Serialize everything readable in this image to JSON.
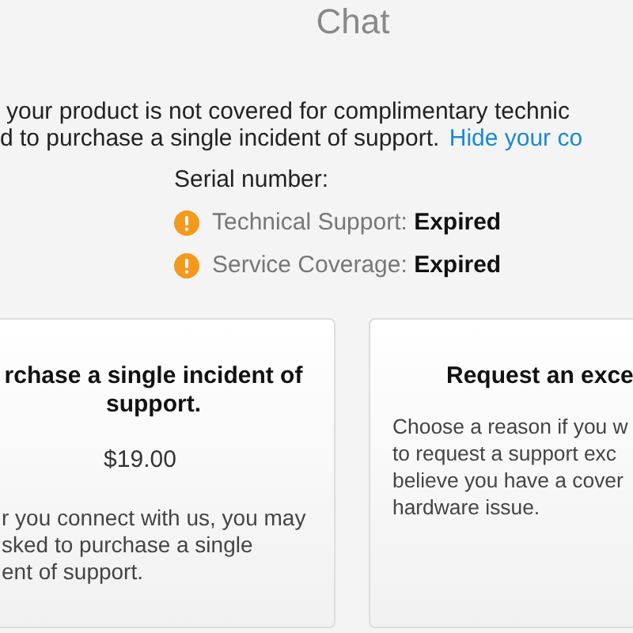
{
  "title": "Chat",
  "intro": {
    "lines": [
      "your product is not covered for complimentary technic",
      "d to purchase a single incident of support."
    ],
    "link": "Hide your co"
  },
  "serial_label": "Serial number:",
  "coverage": [
    {
      "kind": "warning",
      "label": "Technical Support:",
      "value": "Expired"
    },
    {
      "kind": "warning",
      "label": "Service Coverage:",
      "value": "Expired"
    }
  ],
  "cards": [
    {
      "title_lines": [
        "rchase a single incident of",
        "support."
      ],
      "price": "$19.00",
      "body_lines": [
        "r you connect with us, you may",
        "sked to purchase a single",
        "ent of support."
      ]
    },
    {
      "title_lines": [
        "Request an exce"
      ],
      "body_lines": [
        "Choose a reason if you w",
        "to request a support exc",
        "believe you have a cover",
        "hardware issue."
      ]
    }
  ]
}
